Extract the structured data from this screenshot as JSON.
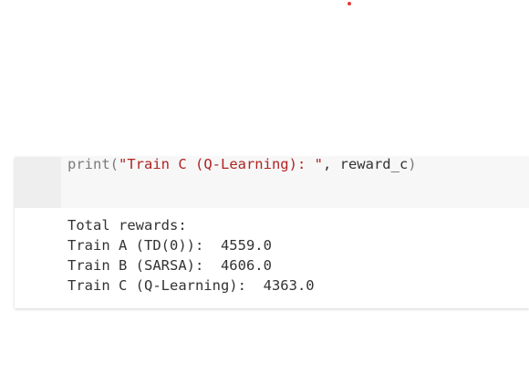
{
  "colors": {
    "cursor_dot": "#e53935",
    "code_function": "#7a7a7a",
    "code_string": "#b22222",
    "code_plain": "#333333",
    "output_text": "#333333"
  },
  "cell": {
    "code": {
      "func": "print(",
      "string": "\"Train C (Q-Learning): \"",
      "rest": ", reward_c",
      "close": ")"
    },
    "output": {
      "lines": [
        "Total rewards:",
        "Train A (TD(0)):  4559.0",
        "Train B (SARSA):  4606.0",
        "Train C (Q-Learning):  4363.0"
      ]
    }
  }
}
